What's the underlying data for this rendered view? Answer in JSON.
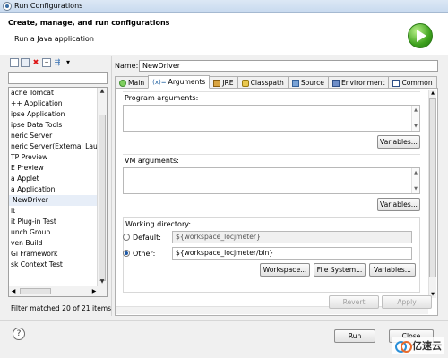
{
  "window": {
    "title": "Run Configurations"
  },
  "header": {
    "title": "Create, manage, and run configurations",
    "subtitle": "Run a Java application"
  },
  "left": {
    "toolbar_icons": [
      "new-config-icon",
      "duplicate-icon",
      "delete-icon",
      "collapse-all-icon",
      "filter-icon"
    ],
    "filter_value": "",
    "tree_items": [
      "ache Tomcat",
      "++ Application",
      "ipse Application",
      "ipse Data Tools",
      "neric Server",
      "neric Server(External Launc",
      "TP Preview",
      "E Preview",
      "a Applet",
      "a Application",
      "NewDriver",
      "it",
      "it Plug-in Test",
      "unch Group",
      "ven Build",
      "Gi Framework",
      "sk Context Test",
      ""
    ],
    "selected_item": "NewDriver",
    "status": "Filter matched 20 of 21 items"
  },
  "right": {
    "name_label": "Name:",
    "name_value": "NewDriver",
    "tabs": [
      {
        "label": "Main",
        "icon": "main-icon"
      },
      {
        "label": "Arguments",
        "icon": "arguments-icon"
      },
      {
        "label": "JRE",
        "icon": "jre-icon"
      },
      {
        "label": "Classpath",
        "icon": "classpath-icon"
      },
      {
        "label": "Source",
        "icon": "source-icon"
      },
      {
        "label": "Environment",
        "icon": "environment-icon"
      },
      {
        "label": "Common",
        "icon": "common-icon"
      }
    ],
    "active_tab": "Arguments",
    "program_arguments": {
      "label": "Program arguments:",
      "value": "",
      "button": "Variables..."
    },
    "vm_arguments": {
      "label": "VM arguments:",
      "value": "",
      "button": "Variables..."
    },
    "working_directory": {
      "label": "Working directory:",
      "default_label": "Default:",
      "default_value": "${workspace_locjmeter}",
      "other_label": "Other:",
      "other_value": "${workspace_locjmeter/bin}",
      "selected": "Other",
      "buttons": [
        "Workspace...",
        "File System...",
        "Variables..."
      ]
    },
    "revert_label": "Revert",
    "apply_label": "Apply"
  },
  "bottom": {
    "help": "?",
    "run_label": "Run",
    "close_label": "Close"
  },
  "watermark": "亿速云"
}
